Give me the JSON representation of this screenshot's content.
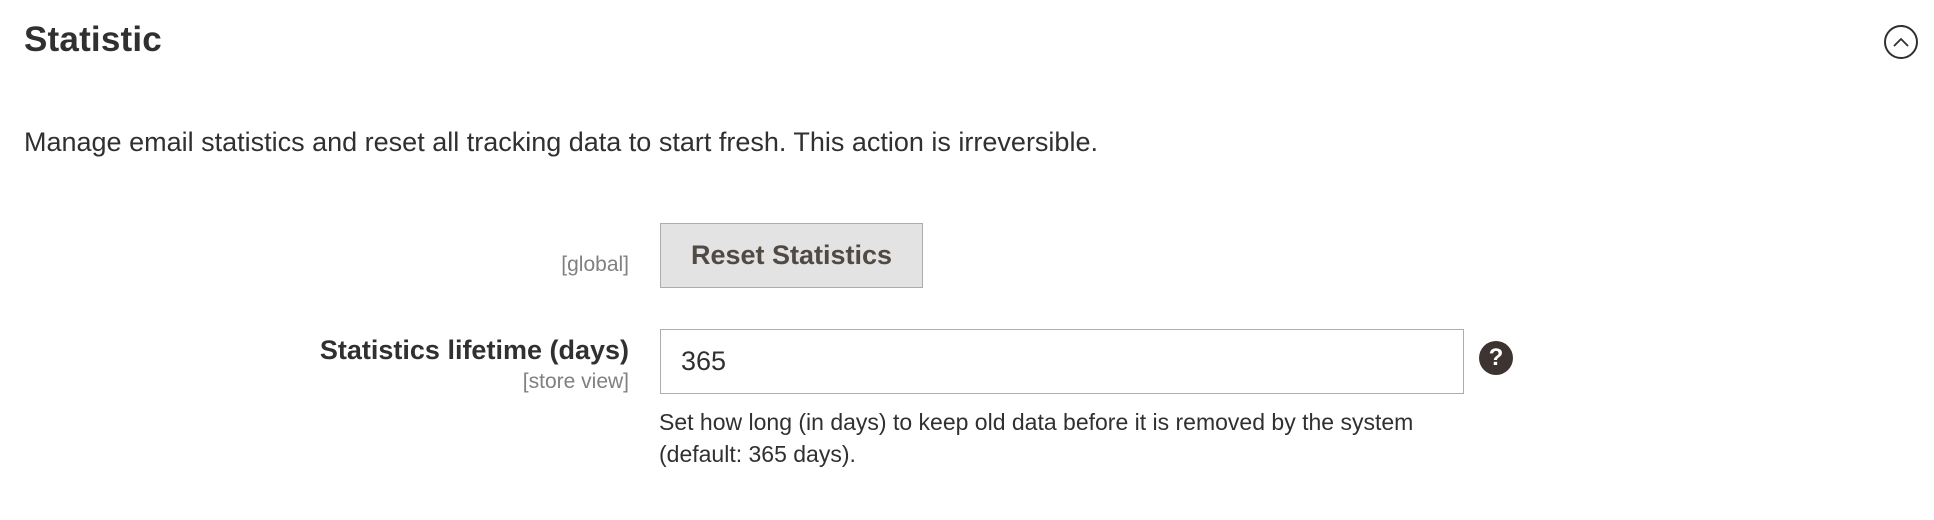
{
  "section": {
    "title": "Statistic",
    "toggle_icon": "chevron-up-circle-icon",
    "description": "Manage email statistics and reset all tracking data to start fresh. This action is irreversible."
  },
  "reset_row": {
    "scope": "[global]",
    "button_label": "Reset Statistics"
  },
  "lifetime_row": {
    "label": "Statistics lifetime (days)",
    "scope": "[store view]",
    "value": "365",
    "help_icon": "question-mark-icon",
    "note": "Set how long (in days) to keep old data before it is removed by the system (default: 365 days)."
  },
  "colors": {
    "text": "#303030",
    "muted": "#808080",
    "button_bg": "#e3e3e3",
    "button_text": "#514943",
    "border": "#adadad",
    "help_bg": "#3d3431"
  }
}
